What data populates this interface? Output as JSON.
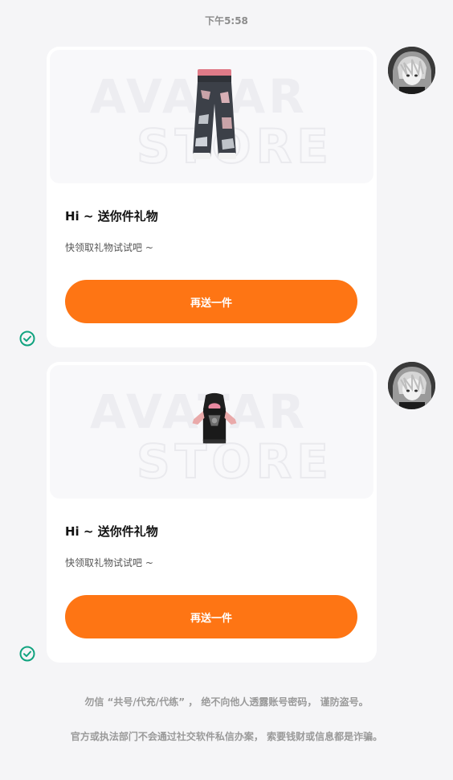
{
  "timestamp": "下午5:58",
  "watermark": {
    "line1": "AVATAR",
    "line2": "STORE"
  },
  "messages": [
    {
      "title": "Hi ~ 送你件礼物",
      "description": "快领取礼物试试吧 ~",
      "button_label": "再送一件",
      "product_icon": "jeans-icon"
    },
    {
      "title": "Hi ~ 送你件礼物",
      "description": "快领取礼物试试吧 ~",
      "button_label": "再送一件",
      "product_icon": "shirt-icon"
    }
  ],
  "footer": {
    "line1": "勿信 “共号/代充/代练” ， 绝不向他人透露账号密码， 谨防盗号。",
    "line2": "官方或执法部门不会通过社交软件私信办案， 索要钱财或信息都是诈骗。"
  },
  "colors": {
    "accent": "#fe7514",
    "check": "#10a37f",
    "background": "#f5f5f7"
  }
}
